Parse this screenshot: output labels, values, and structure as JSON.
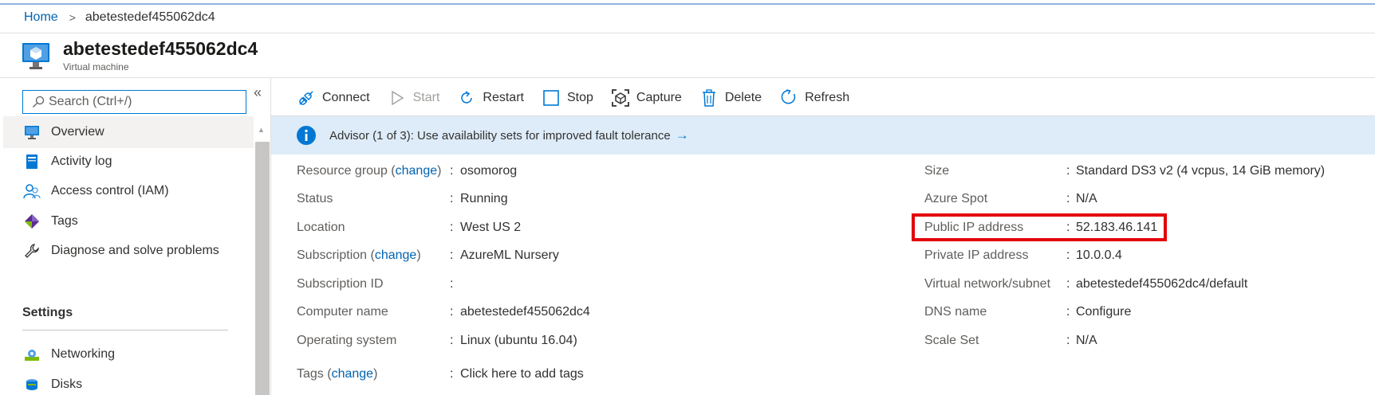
{
  "breadcrumb": {
    "home": "Home",
    "separator": ">",
    "current": "abetestedef455062dc4"
  },
  "resource": {
    "name": "abetestedef455062dc4",
    "type": "Virtual machine"
  },
  "sidebar": {
    "search_placeholder": "Search (Ctrl+/)",
    "collapse_glyph": "«",
    "items": [
      {
        "label": "Overview",
        "icon": "monitor-icon",
        "active": true
      },
      {
        "label": "Activity log",
        "icon": "activity-log-icon"
      },
      {
        "label": "Access control (IAM)",
        "icon": "people-icon"
      },
      {
        "label": "Tags",
        "icon": "tag-icon"
      },
      {
        "label": "Diagnose and solve problems",
        "icon": "wrench-icon"
      }
    ],
    "settings_header": "Settings",
    "settings_items": [
      {
        "label": "Networking",
        "icon": "networking-icon"
      },
      {
        "label": "Disks",
        "icon": "disks-icon"
      }
    ]
  },
  "toolbar": {
    "connect": "Connect",
    "start": "Start",
    "restart": "Restart",
    "stop": "Stop",
    "capture": "Capture",
    "delete": "Delete",
    "refresh": "Refresh"
  },
  "advisor": {
    "text": "Advisor (1 of 3): Use availability sets for improved fault tolerance",
    "arrow": "→"
  },
  "essentials": {
    "left": [
      {
        "label": "Resource group",
        "change": "change",
        "value": "osomorog",
        "value_link": true
      },
      {
        "label": "Status",
        "value": "Running"
      },
      {
        "label": "Location",
        "value": "West US 2"
      },
      {
        "label": "Subscription",
        "change": "change",
        "value": "AzureML Nursery",
        "value_link": true
      },
      {
        "label": "Subscription ID",
        "value": ""
      },
      {
        "label": "Computer name",
        "value": "abetestedef455062dc4"
      },
      {
        "label": "Operating system",
        "value": "Linux (ubuntu 16.04)"
      },
      {
        "label": "Tags",
        "change": "change",
        "value": "Click here to add tags",
        "value_link": true
      }
    ],
    "right": [
      {
        "label": "Size",
        "value": "Standard DS3 v2 (4 vcpus, 14 GiB memory)"
      },
      {
        "label": "Azure Spot",
        "value": "N/A"
      },
      {
        "label": "Public IP address",
        "value": "52.183.46.141",
        "value_link": true
      },
      {
        "label": "Private IP address",
        "value": "10.0.0.4"
      },
      {
        "label": "Virtual network/subnet",
        "value": "abetestedef455062dc4/default",
        "value_link": true
      },
      {
        "label": "DNS name",
        "value": "Configure",
        "value_link": true
      },
      {
        "label": "Scale Set",
        "value": "N/A"
      }
    ]
  },
  "colors": {
    "link": "#0063b1",
    "accent": "#0078d4",
    "banner": "#deecf9",
    "highlight": "#e3000b"
  }
}
